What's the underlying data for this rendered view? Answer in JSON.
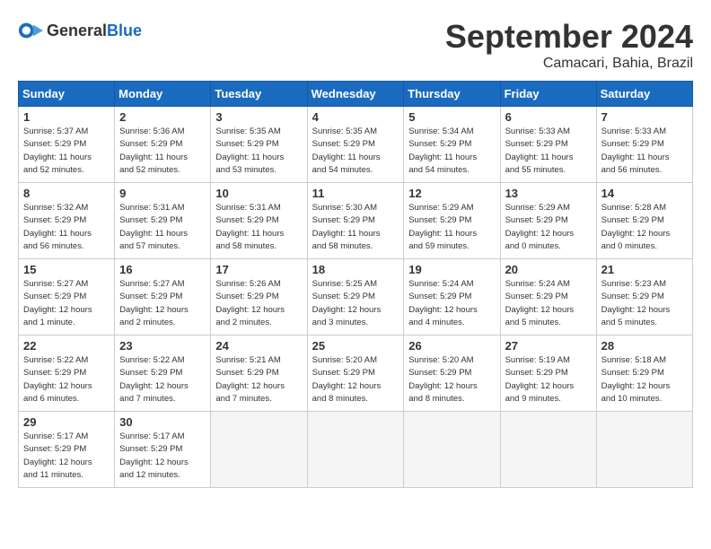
{
  "logo": {
    "general": "General",
    "blue": "Blue"
  },
  "title": "September 2024",
  "location": "Camacari, Bahia, Brazil",
  "headers": [
    "Sunday",
    "Monday",
    "Tuesday",
    "Wednesday",
    "Thursday",
    "Friday",
    "Saturday"
  ],
  "weeks": [
    [
      {
        "day": "1",
        "info": "Sunrise: 5:37 AM\nSunset: 5:29 PM\nDaylight: 11 hours\nand 52 minutes."
      },
      {
        "day": "2",
        "info": "Sunrise: 5:36 AM\nSunset: 5:29 PM\nDaylight: 11 hours\nand 52 minutes."
      },
      {
        "day": "3",
        "info": "Sunrise: 5:35 AM\nSunset: 5:29 PM\nDaylight: 11 hours\nand 53 minutes."
      },
      {
        "day": "4",
        "info": "Sunrise: 5:35 AM\nSunset: 5:29 PM\nDaylight: 11 hours\nand 54 minutes."
      },
      {
        "day": "5",
        "info": "Sunrise: 5:34 AM\nSunset: 5:29 PM\nDaylight: 11 hours\nand 54 minutes."
      },
      {
        "day": "6",
        "info": "Sunrise: 5:33 AM\nSunset: 5:29 PM\nDaylight: 11 hours\nand 55 minutes."
      },
      {
        "day": "7",
        "info": "Sunrise: 5:33 AM\nSunset: 5:29 PM\nDaylight: 11 hours\nand 56 minutes."
      }
    ],
    [
      {
        "day": "8",
        "info": "Sunrise: 5:32 AM\nSunset: 5:29 PM\nDaylight: 11 hours\nand 56 minutes."
      },
      {
        "day": "9",
        "info": "Sunrise: 5:31 AM\nSunset: 5:29 PM\nDaylight: 11 hours\nand 57 minutes."
      },
      {
        "day": "10",
        "info": "Sunrise: 5:31 AM\nSunset: 5:29 PM\nDaylight: 11 hours\nand 58 minutes."
      },
      {
        "day": "11",
        "info": "Sunrise: 5:30 AM\nSunset: 5:29 PM\nDaylight: 11 hours\nand 58 minutes."
      },
      {
        "day": "12",
        "info": "Sunrise: 5:29 AM\nSunset: 5:29 PM\nDaylight: 11 hours\nand 59 minutes."
      },
      {
        "day": "13",
        "info": "Sunrise: 5:29 AM\nSunset: 5:29 PM\nDaylight: 12 hours\nand 0 minutes."
      },
      {
        "day": "14",
        "info": "Sunrise: 5:28 AM\nSunset: 5:29 PM\nDaylight: 12 hours\nand 0 minutes."
      }
    ],
    [
      {
        "day": "15",
        "info": "Sunrise: 5:27 AM\nSunset: 5:29 PM\nDaylight: 12 hours\nand 1 minute."
      },
      {
        "day": "16",
        "info": "Sunrise: 5:27 AM\nSunset: 5:29 PM\nDaylight: 12 hours\nand 2 minutes."
      },
      {
        "day": "17",
        "info": "Sunrise: 5:26 AM\nSunset: 5:29 PM\nDaylight: 12 hours\nand 2 minutes."
      },
      {
        "day": "18",
        "info": "Sunrise: 5:25 AM\nSunset: 5:29 PM\nDaylight: 12 hours\nand 3 minutes."
      },
      {
        "day": "19",
        "info": "Sunrise: 5:24 AM\nSunset: 5:29 PM\nDaylight: 12 hours\nand 4 minutes."
      },
      {
        "day": "20",
        "info": "Sunrise: 5:24 AM\nSunset: 5:29 PM\nDaylight: 12 hours\nand 5 minutes."
      },
      {
        "day": "21",
        "info": "Sunrise: 5:23 AM\nSunset: 5:29 PM\nDaylight: 12 hours\nand 5 minutes."
      }
    ],
    [
      {
        "day": "22",
        "info": "Sunrise: 5:22 AM\nSunset: 5:29 PM\nDaylight: 12 hours\nand 6 minutes."
      },
      {
        "day": "23",
        "info": "Sunrise: 5:22 AM\nSunset: 5:29 PM\nDaylight: 12 hours\nand 7 minutes."
      },
      {
        "day": "24",
        "info": "Sunrise: 5:21 AM\nSunset: 5:29 PM\nDaylight: 12 hours\nand 7 minutes."
      },
      {
        "day": "25",
        "info": "Sunrise: 5:20 AM\nSunset: 5:29 PM\nDaylight: 12 hours\nand 8 minutes."
      },
      {
        "day": "26",
        "info": "Sunrise: 5:20 AM\nSunset: 5:29 PM\nDaylight: 12 hours\nand 8 minutes."
      },
      {
        "day": "27",
        "info": "Sunrise: 5:19 AM\nSunset: 5:29 PM\nDaylight: 12 hours\nand 9 minutes."
      },
      {
        "day": "28",
        "info": "Sunrise: 5:18 AM\nSunset: 5:29 PM\nDaylight: 12 hours\nand 10 minutes."
      }
    ],
    [
      {
        "day": "29",
        "info": "Sunrise: 5:17 AM\nSunset: 5:29 PM\nDaylight: 12 hours\nand 11 minutes."
      },
      {
        "day": "30",
        "info": "Sunrise: 5:17 AM\nSunset: 5:29 PM\nDaylight: 12 hours\nand 12 minutes."
      },
      null,
      null,
      null,
      null,
      null
    ]
  ]
}
